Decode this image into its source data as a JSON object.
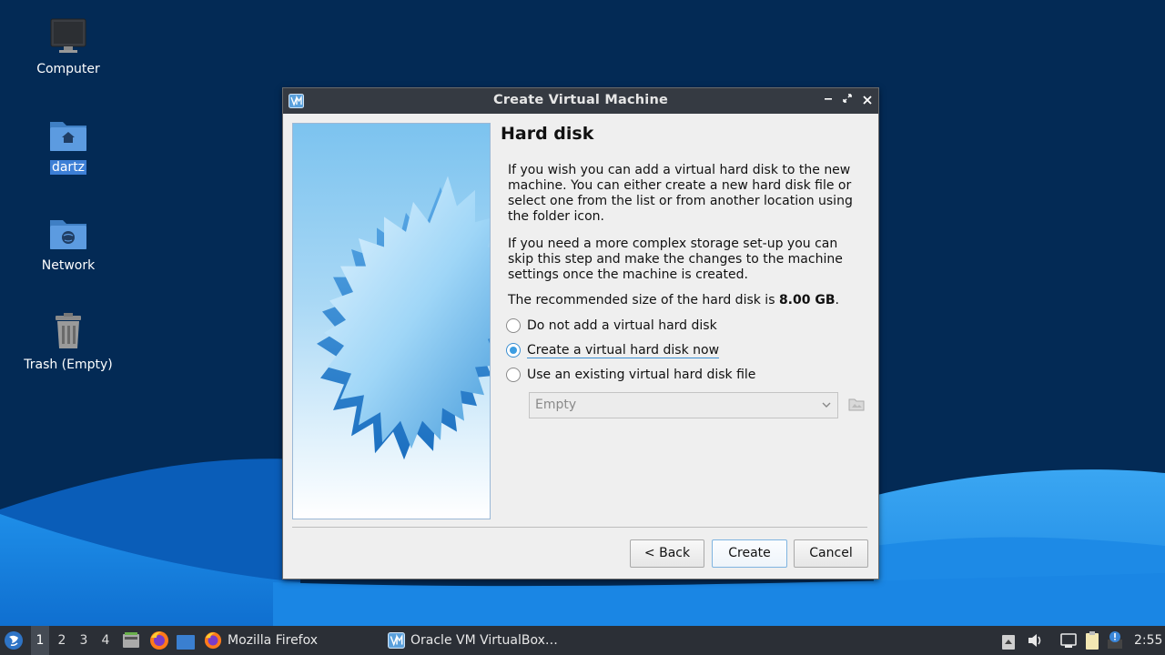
{
  "desktop": {
    "icons": [
      {
        "label": "Computer",
        "icon": "computer-icon"
      },
      {
        "label": "dartz",
        "icon": "home-folder-icon"
      },
      {
        "label": "Network",
        "icon": "network-folder-icon"
      },
      {
        "label": "Trash (Empty)",
        "icon": "trash-icon"
      }
    ]
  },
  "dialog": {
    "title": "Create Virtual Machine",
    "heading": "Hard disk",
    "para1": "If you wish you can add a virtual hard disk to the new machine. You can either create a new hard disk file or select one from the list or from another location using the folder icon.",
    "para2": "If you need a more complex storage set-up you can skip this step and make the changes to the machine settings once the machine is created.",
    "para3_prefix": "The recommended size of the hard disk is ",
    "para3_size": "8.00 GB",
    "para3_suffix": ".",
    "options": [
      {
        "label": "Do not add a virtual hard disk",
        "checked": false
      },
      {
        "label": "Create a virtual hard disk now",
        "checked": true
      },
      {
        "label": "Use an existing virtual hard disk file",
        "checked": false
      }
    ],
    "disk_select_value": "Empty",
    "buttons": {
      "back": "< Back",
      "create": "Create",
      "cancel": "Cancel"
    }
  },
  "taskbar": {
    "workspaces": [
      "1",
      "2",
      "3",
      "4"
    ],
    "active_workspace": "1",
    "tasks": [
      {
        "label": "Mozilla Firefox",
        "icon": "firefox-icon"
      },
      {
        "label": "Oracle VM VirtualBox…",
        "icon": "virtualbox-icon"
      }
    ],
    "clock": "2:55"
  },
  "colors": {
    "desktop_bg": "#032a55",
    "wave_light": "#1f8fe6",
    "titlebar": "#353a42",
    "accent": "#3c9de2",
    "taskbar": "#2b2f36"
  }
}
